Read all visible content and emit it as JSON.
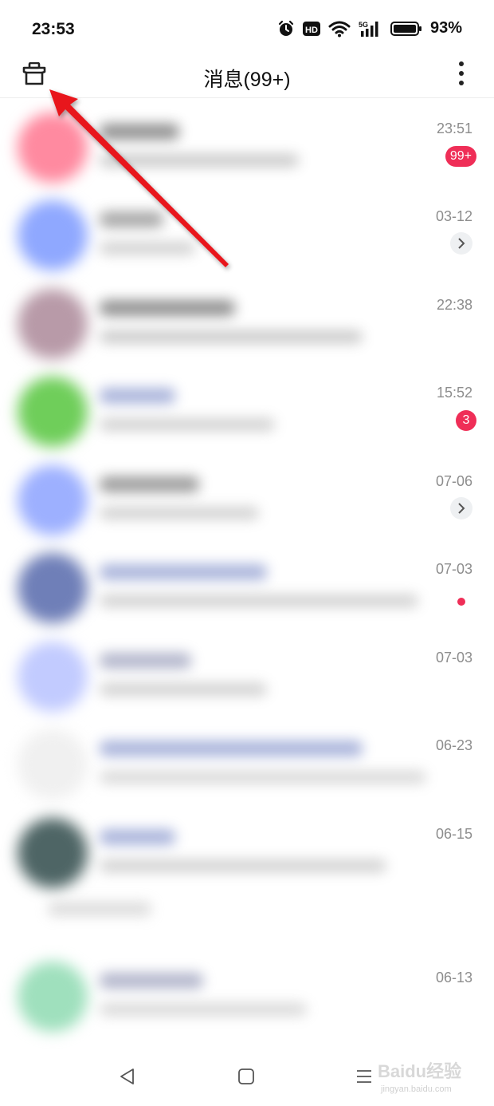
{
  "status_bar": {
    "time": "23:53",
    "battery_percent": "93%",
    "icons": [
      "alarm-icon",
      "hd-icon",
      "wifi-icon",
      "5g-signal-icon",
      "battery-icon"
    ]
  },
  "header": {
    "title": "消息(99+)",
    "left_icon": "cleanup-icon",
    "right_icon": "more-vertical-icon"
  },
  "conversations": [
    {
      "time": "23:51",
      "badge": "99+",
      "indicator": "badge",
      "avatar_color": "#ff8aa0"
    },
    {
      "time": "03-12",
      "badge": "",
      "indicator": "chevron",
      "avatar_color": "#8fa8ff"
    },
    {
      "time": "22:38",
      "badge": "",
      "indicator": "none",
      "avatar_color": "#b89aa8"
    },
    {
      "time": "15:52",
      "badge": "3",
      "indicator": "badge",
      "avatar_color": "#6fce5a"
    },
    {
      "time": "07-06",
      "badge": "",
      "indicator": "chevron",
      "avatar_color": "#9db0ff"
    },
    {
      "time": "07-03",
      "badge": "",
      "indicator": "dot",
      "avatar_color": "#6f7fb8"
    },
    {
      "time": "07-03",
      "badge": "",
      "indicator": "none",
      "avatar_color": "#c2cbff"
    },
    {
      "time": "06-23",
      "badge": "",
      "indicator": "none",
      "avatar_color": "#f0f0f0"
    },
    {
      "time": "06-15",
      "badge": "",
      "indicator": "none",
      "avatar_color": "#4e6565"
    },
    {
      "time": "06-13",
      "badge": "",
      "indicator": "none",
      "avatar_color": "#9fe0bd"
    }
  ],
  "nav_bar": {
    "icons": [
      "back-icon",
      "home-icon",
      "recents-icon"
    ]
  },
  "watermark": {
    "text": "Baidu经验",
    "subtext": "jingyan.baidu.com"
  },
  "colors": {
    "badge": "#ef2e57",
    "annotation_arrow": "#e8141b"
  }
}
